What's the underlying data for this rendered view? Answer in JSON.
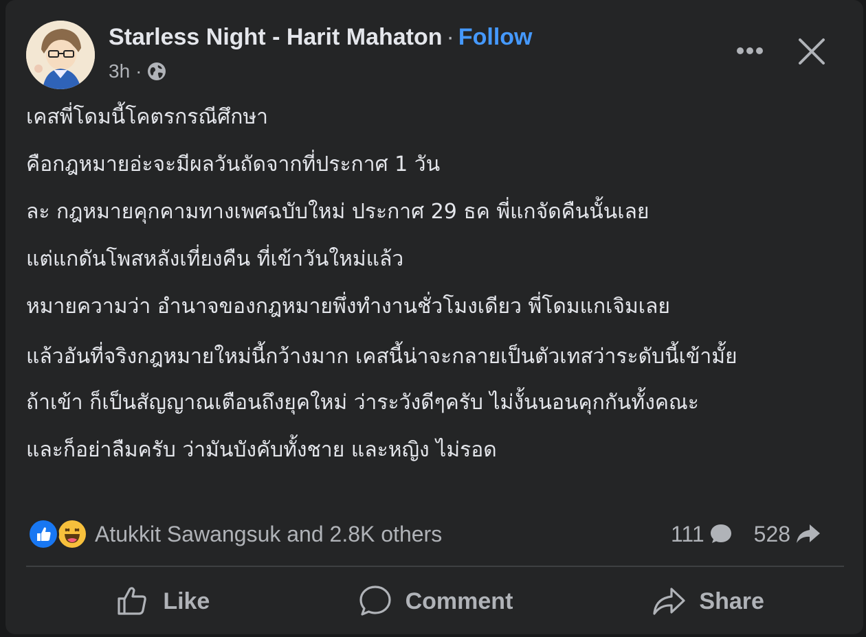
{
  "post": {
    "author": "Starless Night - Harit Mahaton",
    "separator": "·",
    "follow_label": "Follow",
    "time": "3h",
    "meta_dot": "·",
    "privacy_icon": "globe-icon",
    "lines": [
      "เคสพี่โดมนี้โคตรกรณีศึกษา",
      "คือกฎหมายอ่ะจะมีผลวันถัดจากที่ประกาศ 1 วัน",
      "ละ กฎหมายคุกคามทางเพศฉบับใหม่ ประกาศ 29 ธค พี่แกจัดคืนนั้นเลย",
      "แต่แกดันโพสหลังเที่ยงคืน ที่เข้าวันใหม่แล้ว",
      "หมายความว่า อำนาจของกฎหมายพึ่งทำงานชั่วโมงเดียว พี่โดมแกเจิมเลย",
      "แล้วอันที่จริงกฎหมายใหม่นี้กว้างมาก เคสนี้น่าจะกลายเป็นตัวเทสว่าระดับนี้เข้ามั้ย",
      "ถ้าเข้า ก็เป็นสัญญาณเตือนถึงยุคใหม่ ว่าระวังดีๆครับ ไม่งั้นนอนคุกกันทั้งคณะ",
      "และก็อย่าลืมครับ ว่ามันบังคับทั้งชาย และหญิง ไม่รอด"
    ]
  },
  "reactions": {
    "icons": [
      "like-icon",
      "haha-icon"
    ],
    "summary": "Atukkit Sawangsuk and 2.8K others",
    "comments_count": "111",
    "shares_count": "528"
  },
  "actions": {
    "like_label": "Like",
    "comment_label": "Comment",
    "share_label": "Share"
  },
  "colors": {
    "background": "#242526",
    "text": "#e4e6eb",
    "secondary": "#b0b3b8",
    "follow": "#4599ff",
    "like_blue": "#1877f2",
    "haha_yellow": "#f7c03c"
  }
}
